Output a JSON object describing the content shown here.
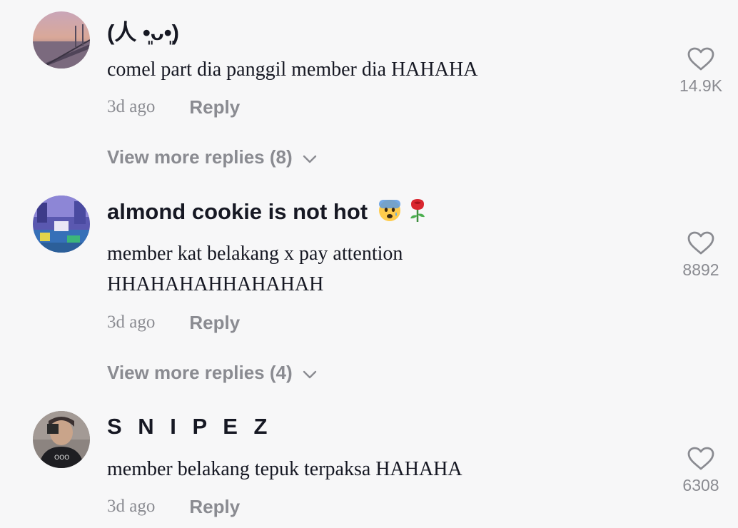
{
  "comments": [
    {
      "username": "(人 •͈ᴗ•͈)",
      "text": "comel part dia panggil member dia HAHAHA",
      "time": "3d ago",
      "reply_label": "Reply",
      "likes": "14.9K",
      "view_more": "View more replies (8)",
      "avatar_icon": "avatar-bridge-sunset"
    },
    {
      "username": "almond cookie is not hot",
      "username_emojis": [
        "anxious-face-icon",
        "rose-icon"
      ],
      "text": "member kat belakang x pay attention HHAHAHAHHAHAHAH",
      "time": "3d ago",
      "reply_label": "Reply",
      "likes": "8892",
      "view_more": "View more replies (4)",
      "avatar_icon": "avatar-arcade-room"
    },
    {
      "username": "S N I P E Z",
      "text": "member belakang tepuk terpaksa HAHAHA",
      "time": "3d ago",
      "reply_label": "Reply",
      "likes": "6308",
      "avatar_icon": "avatar-person-photo"
    }
  ],
  "colors": {
    "background": "#f7f7f8",
    "primary_text": "#161823",
    "secondary_text": "#8a8b91"
  }
}
